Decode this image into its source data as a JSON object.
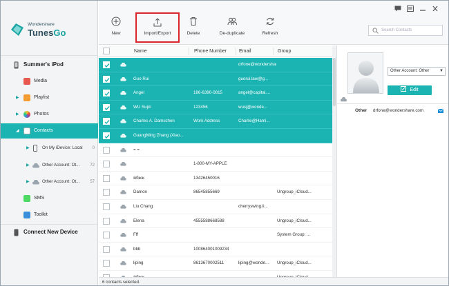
{
  "app": {
    "brand": "Wondershare",
    "product_a": "Tunes",
    "product_b": "Go"
  },
  "sidebar": {
    "device": "Summer's iPod",
    "items": [
      {
        "label": "Media",
        "icon": "music-note-icon"
      },
      {
        "label": "Playlist",
        "icon": "playlist-icon"
      },
      {
        "label": "Photos",
        "icon": "photos-icon"
      },
      {
        "label": "Contacts",
        "icon": "contacts-icon"
      }
    ],
    "sub_items": [
      {
        "label": "On My iDevice: Local",
        "count": "0"
      },
      {
        "label": "Other Account: Ot...",
        "count": "72"
      },
      {
        "label": "Other Account: Ot...",
        "count": "57"
      }
    ],
    "items2": [
      {
        "label": "SMS",
        "icon": "sms-icon"
      },
      {
        "label": "Toolkit",
        "icon": "toolkit-icon"
      }
    ],
    "connect": "Connect New Device"
  },
  "toolbar": {
    "new": "New",
    "import_export": "Import/Export",
    "delete": "Delete",
    "deduplicate": "De-duplicate",
    "refresh": "Refresh",
    "search_placeholder": "Search Contacts"
  },
  "table": {
    "headers": {
      "name": "Name",
      "phone": "Phone Number",
      "email": "Email",
      "group": "Group"
    },
    "rows": [
      {
        "selected": true,
        "name": "",
        "phone": "",
        "email": "drfone@wondershare....",
        "group": ""
      },
      {
        "selected": true,
        "name": "Guo Rui",
        "phone": "",
        "email": "guorui.law@g...",
        "group": ""
      },
      {
        "selected": true,
        "name": "Angel",
        "phone": "186-6390-0815",
        "email": "angel@capital....",
        "group": ""
      },
      {
        "selected": true,
        "name": "WU  Sujin",
        "phone": "123456",
        "email": "wusj@wonde...",
        "group": ""
      },
      {
        "selected": true,
        "name": "Charles A. Damschen",
        "phone": "Work Address",
        "email": "Charlie@Hami...",
        "group": ""
      },
      {
        "selected": true,
        "name": "GuangMing  Zhang (Xiao...",
        "phone": "",
        "email": "",
        "group": ""
      },
      {
        "selected": false,
        "name": "= =",
        "phone": "",
        "email": "",
        "group": ""
      },
      {
        "selected": false,
        "name": "",
        "phone": "1-800-MY-APPLE",
        "email": "",
        "group": ""
      },
      {
        "selected": false,
        "name": "ӝбжж",
        "phone": "13426450016",
        "email": "",
        "group": ""
      },
      {
        "selected": false,
        "name": "Damon",
        "phone": "86545855669",
        "email": "",
        "group": "Ungroup_iCloud..."
      },
      {
        "selected": false,
        "name": "Liu Chang",
        "phone": "",
        "email": "cherryswing.li...",
        "group": ""
      },
      {
        "selected": false,
        "name": "Elena",
        "phone": "4555588668588",
        "email": "",
        "group": "Ungroup_iCloud..."
      },
      {
        "selected": false,
        "name": "Fff",
        "phone": "",
        "email": "",
        "group": "System Group: ..."
      },
      {
        "selected": false,
        "name": "bbb",
        "phone": "100864001009234",
        "email": "",
        "group": ""
      },
      {
        "selected": false,
        "name": "liping",
        "phone": "8613670002511",
        "email": "liping@wonde...",
        "group": "Ungroup_iCloud..."
      },
      {
        "selected": false,
        "name": "ӝбжж",
        "phone": "",
        "email": "",
        "group": "Ungroup_iCloud..."
      }
    ]
  },
  "detail": {
    "account": "Other Account: Other",
    "edit": "Edit",
    "field_label": "Other",
    "field_value": "drfone@wondershare.com"
  },
  "status": "6 contacts selected.",
  "colors": {
    "accent": "#1cb4b2",
    "highlight_border": "#d9262c"
  }
}
